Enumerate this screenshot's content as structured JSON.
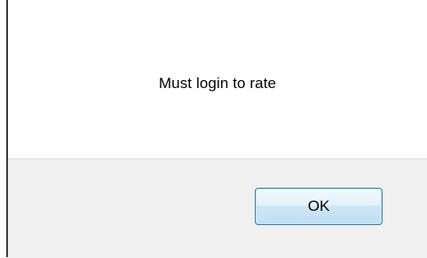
{
  "dialog": {
    "message": "Must login to rate",
    "ok_label": "OK"
  }
}
